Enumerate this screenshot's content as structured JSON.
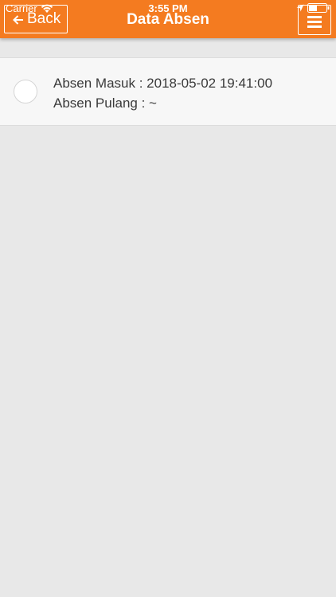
{
  "status_bar": {
    "carrier": "Carrier",
    "time": "3:55 PM"
  },
  "navbar": {
    "back_label": "Back",
    "title": "Data Absen"
  },
  "absen_list": [
    {
      "masuk_label": "Absen Masuk : 2018-05-02 19:41:00",
      "pulang_label": "Absen Pulang : ~"
    }
  ],
  "colors": {
    "header": "#f47b20",
    "background": "#e8e8e8",
    "list_item": "#f7f7f7"
  },
  "icons": [
    "wifi-icon",
    "location-icon",
    "battery-icon",
    "back-arrow-icon",
    "hamburger-icon"
  ]
}
